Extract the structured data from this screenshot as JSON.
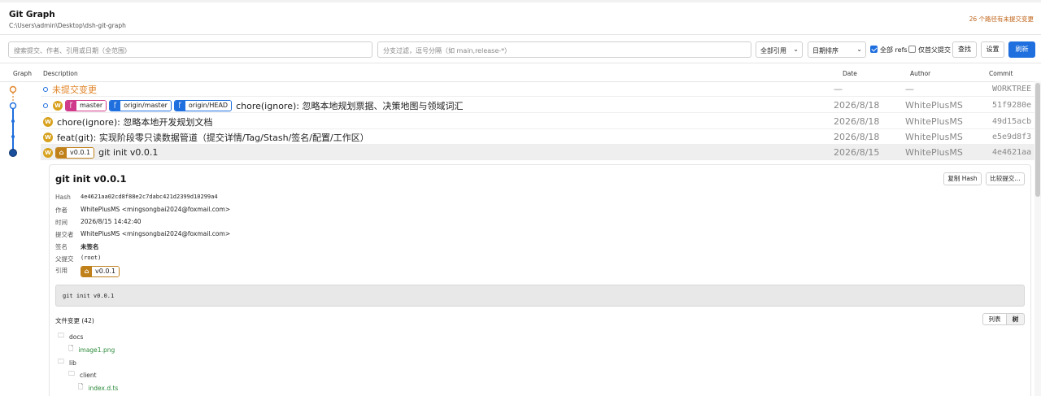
{
  "app": {
    "title": "Git Graph",
    "path": "C:\\Users\\admin\\Desktop\\dsh-git-graph",
    "pending_notice": "26 个路径有未提交变更"
  },
  "toolbar": {
    "search_placeholder": "搜索提交、作者、引用或日期（全范围）",
    "branch_filter_placeholder": "分支过滤，逗号分隔（如 main,release-*）",
    "refs_select": "全部引用",
    "sort_select": "日期排序",
    "all_refs_label": "全部 refs",
    "all_refs_checked": true,
    "first_parent_label": "仅首父提交",
    "first_parent_checked": false,
    "find_button": "查找",
    "settings_button": "设置",
    "refresh_button": "刷新"
  },
  "columns": {
    "graph": "Graph",
    "description": "Description",
    "date": "Date",
    "author": "Author",
    "commit": "Commit"
  },
  "commits": [
    {
      "message": "未提交变更",
      "date": "—",
      "author": "—",
      "hash": "WORKTREE",
      "refs": [],
      "avatar": ""
    },
    {
      "message": "chore(ignore): 忽略本地规划票据、决策地图与领域词汇",
      "date": "2026/8/18",
      "author": "WhitePlusMS",
      "hash": "51f9280e",
      "avatar": "W",
      "refs": [
        {
          "name": "master",
          "kind": "local"
        },
        {
          "name": "origin/master",
          "kind": "remote"
        },
        {
          "name": "origin/HEAD",
          "kind": "remote"
        }
      ]
    },
    {
      "message": "chore(ignore): 忽略本地开发规划文档",
      "date": "2026/8/18",
      "author": "WhitePlusMS",
      "hash": "49d15acb",
      "avatar": "W",
      "refs": []
    },
    {
      "message": "feat(git): 实现阶段零只读数据管道（提交详情/Tag/Stash/签名/配置/工作区）",
      "date": "2026/8/18",
      "author": "WhitePlusMS",
      "hash": "e5e9d8f3",
      "avatar": "W",
      "refs": []
    },
    {
      "message": "git init v0.0.1",
      "date": "2026/8/15",
      "author": "WhitePlusMS",
      "hash": "4e4621aa",
      "avatar": "W",
      "refs": [
        {
          "name": "v0.0.1",
          "kind": "tag"
        }
      ]
    }
  ],
  "detail": {
    "title": "git init v0.0.1",
    "copy_hash_button": "复制 Hash",
    "compare_button": "比较提交...",
    "fields": [
      {
        "key": "Hash",
        "value": "4e4621aa02cd8f88e2c7dabc421d2399d10299a4",
        "style": "mono"
      },
      {
        "key": "作者",
        "value": "WhitePlusMS <mingsongbai2024@foxmail.com>",
        "style": ""
      },
      {
        "key": "时间",
        "value": "2026/8/15 14:42:40",
        "style": ""
      },
      {
        "key": "提交者",
        "value": "WhitePlusMS <mingsongbai2024@foxmail.com>",
        "style": ""
      },
      {
        "key": "签名",
        "value": "未签名",
        "style": "bold"
      },
      {
        "key": "父提交",
        "value": "(root)",
        "style": "mono"
      },
      {
        "key": "引用",
        "value": "",
        "style": ""
      }
    ],
    "ref_tag": "v0.0.1",
    "message": "git init v0.0.1",
    "files_title": "文件变更 (42)",
    "view_list": "列表",
    "view_tree": "树",
    "tree": [
      {
        "name": "docs",
        "type": "dir",
        "depth": 0
      },
      {
        "name": "image1.png",
        "type": "file",
        "depth": 1
      },
      {
        "name": "lib",
        "type": "dir",
        "depth": 0
      },
      {
        "name": "client",
        "type": "dir",
        "depth": 1
      },
      {
        "name": "index.d.ts",
        "type": "file",
        "depth": 2
      }
    ]
  },
  "colors": {
    "accent": "#1f6fde",
    "pending": "#e0852a",
    "local_branch": "#d03a8a",
    "tag": "#c0801a",
    "avatar": "#d8a11e"
  }
}
